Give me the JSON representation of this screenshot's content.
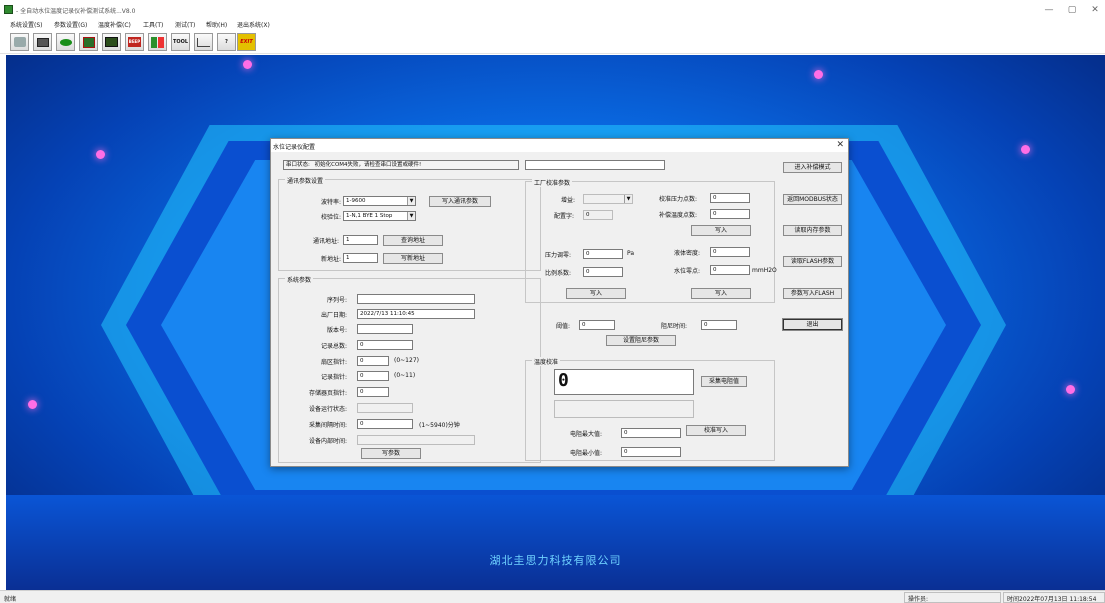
{
  "window": {
    "title": "- 全自动水位温度记录仪补偿测试系统...V8.0",
    "minimize": "—",
    "maximize": "▢",
    "close": "✕"
  },
  "menu": [
    "系统设置(S)",
    "参数设置(G)",
    "温度补偿(C)",
    "工具(T)",
    "测试(T)",
    "帮助(H)",
    "退出系统(X)"
  ],
  "toolbar": [
    "tool-icon-1",
    "tool-icon-2",
    "tool-icon-3",
    "tool-icon-4",
    "tool-icon-5",
    "tool-icon-6",
    "tool-icon-7",
    "TOOL",
    "tool-icon-9",
    "?",
    "EXIT"
  ],
  "desktop": {
    "company": "湖北圭思力科技有限公司"
  },
  "dialog": {
    "title": "水位记录仪配置",
    "close": "✕",
    "port_status_label": "串口状态:",
    "port_status_value": "初始化COM4失败，请检查串口设置或硬件!",
    "comm": {
      "legend": "通讯参数设置",
      "baud_label": "波特率:",
      "baud_value": "1-9600",
      "check_label": "校验位:",
      "check_value": "1-N,1 BYE  1 Stop",
      "write_btn": "写入通讯参数",
      "addr_label": "通讯地址:",
      "addr_value": "1",
      "query_btn": "查询地址",
      "newaddr_label": "新地址:",
      "newaddr_value": "1",
      "write_addr_btn": "写新地址"
    },
    "sys": {
      "legend": "系统参数",
      "serial_label": "序列号:",
      "serial_value": "",
      "date_label": "出厂日期:",
      "date_value": "2022/7/13 11:10:45",
      "ver_label": "版本号:",
      "ver_value": "",
      "total_label": "记录总数:",
      "total_value": "0",
      "sector_label": "扇区指针:",
      "sector_value": "0",
      "sector_range": "(0~127)",
      "rec_label": "记录指针:",
      "rec_value": "0",
      "rec_range": "(0~11)",
      "page_label": "存储器页指针:",
      "page_value": "0",
      "run_label": "设备运行状态:",
      "run_value": "",
      "interval_label": "采集间隔时间:",
      "interval_value": "0",
      "interval_range": "(1~5940)分钟",
      "devtime_label": "设备内部时间:",
      "devtime_value": "",
      "write_btn": "写参数"
    },
    "top_right_field": "",
    "factory": {
      "legend": "工厂校准参数",
      "gain_label": "增益:",
      "config_label": "配置字:",
      "config_value": "0",
      "cal_points_label": "校准压力点数:",
      "cal_points_value": "0",
      "temp_points_label": "补偿温度点数:",
      "temp_points_value": "0",
      "write_btn1": "写入",
      "pressure_label": "压力调零:",
      "pressure_value": "0",
      "pressure_unit": "Pa",
      "density_label": "液体密度:",
      "density_value": "0",
      "ratio_label": "比例系数:",
      "ratio_value": "0",
      "zero_label": "水位零点:",
      "zero_value": "0",
      "zero_unit": "mmH2O",
      "write_btn2": "写入",
      "write_btn3": "写入"
    },
    "threshold_label": "阈值:",
    "threshold_value": "0",
    "damping_label": "阻尼时间:",
    "damping_value": "0",
    "damping_btn": "设置阻尼参数",
    "temp": {
      "legend": "温度校准",
      "display_value": "0",
      "collect_btn": "采集电阻值",
      "max_label": "电阻最大值:",
      "max_value": "0",
      "min_label": "电阻最小值:",
      "min_value": "0",
      "cal_write_btn": "校准写入"
    },
    "side_buttons": [
      "进入补偿模式",
      "返回MODBUS状态",
      "读取内存参数",
      "读取FLASH参数",
      "参数写入FLASH"
    ],
    "exit_btn": "退出"
  },
  "status": {
    "ready": "就绪",
    "operator_label": "操作员:",
    "time": "时间2022年07月13日 11:18:54"
  }
}
